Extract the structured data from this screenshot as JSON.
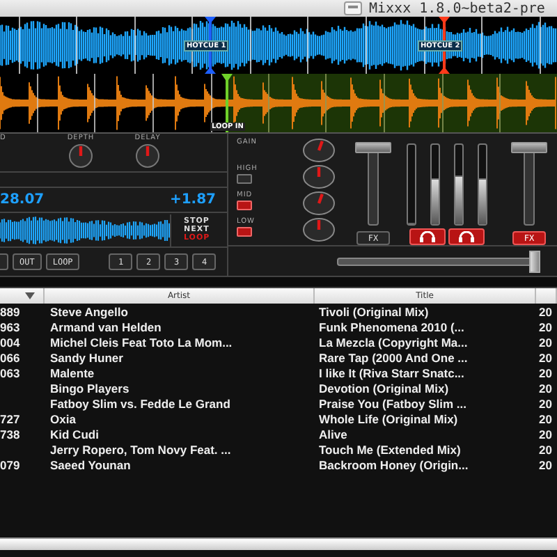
{
  "window": {
    "title": "Mixxx 1.8.0~beta2-pre"
  },
  "waveform_overview": {
    "hotcues": [
      {
        "label": "HOTCUE 1"
      },
      {
        "label": "HOTCUE 2"
      }
    ]
  },
  "waveform_detail": {
    "loop_marker": "LOOP IN"
  },
  "effects": {
    "knobs": [
      {
        "label": "D"
      },
      {
        "label": "DEPTH"
      },
      {
        "label": "DELAY"
      }
    ]
  },
  "deck": {
    "bpm": "28.07",
    "pitch": "+1.87",
    "loop_status": [
      {
        "text": "STOP",
        "kind": "normal"
      },
      {
        "text": "NEXT",
        "kind": "normal"
      },
      {
        "text": "LOOP",
        "kind": "active"
      }
    ],
    "loop_buttons": [
      "OUT",
      "LOOP"
    ],
    "hotcue_buttons": [
      "1",
      "2",
      "3",
      "4"
    ]
  },
  "eq": [
    {
      "label": "GAIN",
      "kind": "gain"
    },
    {
      "label": "HIGH",
      "kind": "band",
      "kill": false
    },
    {
      "label": "MID",
      "kind": "band",
      "kill": true
    },
    {
      "label": "LOW",
      "kind": "band",
      "kill": true
    }
  ],
  "mixer": {
    "channel_fader": {
      "level": 1
    },
    "fx_left": {
      "label": "FX",
      "on": false
    },
    "headphones": [
      {
        "on": true
      },
      {
        "on": true
      }
    ],
    "vu_meters": [
      {
        "level": 0
      },
      {
        "level": 0.57
      },
      {
        "level": 0.6
      },
      {
        "level": 0.57
      }
    ],
    "fx_right": {
      "label": "FX",
      "on": true
    },
    "right_fader": {
      "level": 1
    },
    "crossfader": {
      "level": 1
    }
  },
  "library": {
    "columns": [
      "Artist",
      "Title"
    ],
    "rows": [
      {
        "column_1": "889",
        "artist": "Steve Angello",
        "title": "Tivoli (Original Mix)",
        "column_4": "20"
      },
      {
        "column_1": "963",
        "artist": "Armand van Helden",
        "title": "Funk Phenomena 2010 (...",
        "column_4": "20"
      },
      {
        "column_1": "004",
        "artist": "Michel Cleis Feat Toto La Mom...",
        "title": "La Mezcla (Copyright Ma...",
        "column_4": "20"
      },
      {
        "column_1": "066",
        "artist": "Sandy Huner",
        "title": "Rare Tap (2000 And One ...",
        "column_4": "20"
      },
      {
        "column_1": "063",
        "artist": "Malente",
        "title": "I like It (Riva Starr Snatc...",
        "column_4": "20"
      },
      {
        "artist": "Bingo Players",
        "title": "Devotion (Original Mix)",
        "column_4": "20"
      },
      {
        "artist": "Fatboy Slim vs. Fedde Le Grand",
        "title": "Praise You (Fatboy Slim ...",
        "column_4": "20"
      },
      {
        "column_1": "727",
        "artist": "Oxia",
        "title": "Whole Life (Original Mix)",
        "column_4": "20"
      },
      {
        "column_1": "738",
        "artist": "Kid Cudi",
        "title": "Alive",
        "column_4": "20"
      },
      {
        "artist": "Jerry Ropero, Tom Novy Feat. ...",
        "title": "Touch Me (Extended Mix)",
        "column_4": "20"
      },
      {
        "column_1": "079",
        "artist": "Saeed Younan",
        "title": "Backroom Honey (Origin...",
        "column_4": "20"
      }
    ]
  }
}
